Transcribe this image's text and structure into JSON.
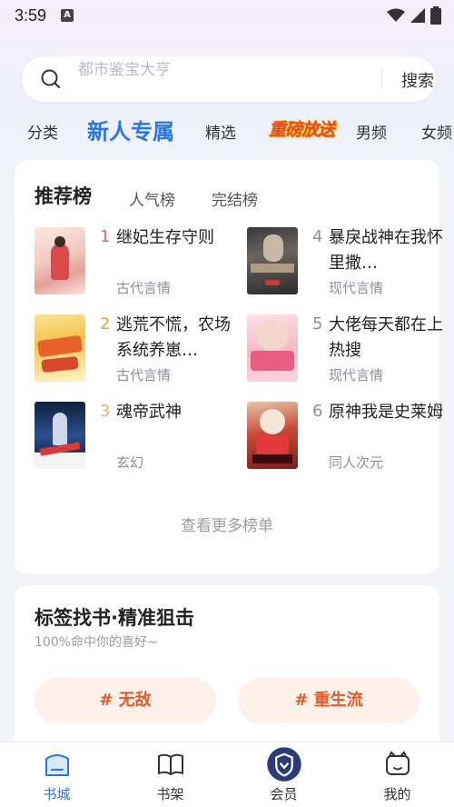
{
  "status_bar": {
    "time": "3:59",
    "notification_icon": "A"
  },
  "search": {
    "placeholder": "都市鉴宝大亨",
    "button_label": "搜索"
  },
  "tabs": [
    {
      "label": "分类"
    },
    {
      "label": "新人专属",
      "active": true
    },
    {
      "label": "精选"
    },
    {
      "label": "重磅放送",
      "logo": true
    },
    {
      "label": "男频"
    },
    {
      "label": "女频"
    }
  ],
  "ranking": {
    "tabs": [
      {
        "label": "推荐榜",
        "active": true
      },
      {
        "label": "人气榜"
      },
      {
        "label": "完结榜"
      }
    ],
    "books": [
      {
        "rank": "1",
        "title": "继妃生存守则",
        "genre": "古代言情"
      },
      {
        "rank": "2",
        "title": "逃荒不慌，农场系统养崽…",
        "genre": "古代言情"
      },
      {
        "rank": "3",
        "title": "魂帝武神",
        "genre": "玄幻"
      },
      {
        "rank": "4",
        "title": "暴戾战神在我怀里撒…",
        "genre": "现代言情"
      },
      {
        "rank": "5",
        "title": "大佬每天都在上热搜",
        "genre": "现代言情"
      },
      {
        "rank": "6",
        "title": "原神我是史莱姆",
        "genre": "同人次元"
      }
    ],
    "more_label": "查看更多榜单"
  },
  "tag_section": {
    "title": "标签找书·精准狙击",
    "subtitle": "100%命中你的喜好~",
    "tags": [
      {
        "label": "# 无敌"
      },
      {
        "label": "# 重生流"
      }
    ]
  },
  "bottom_nav": [
    {
      "label": "书城",
      "icon": "bookstore-icon",
      "active": true
    },
    {
      "label": "书架",
      "icon": "bookshelf-icon"
    },
    {
      "label": "会员",
      "icon": "vip-shield-icon"
    },
    {
      "label": "我的",
      "icon": "profile-icon"
    }
  ],
  "colors": {
    "accent": "#2a76e6",
    "rank_top": "#e8676b",
    "rank_second": "#f0a238",
    "rank_third": "#e4b66a",
    "rank_other": "#8d8f96",
    "tag_text": "#e35c28"
  }
}
